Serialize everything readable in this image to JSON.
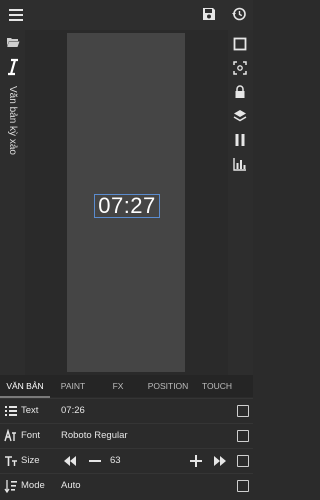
{
  "topbar": {
    "menu_icon": "menu-icon",
    "save_icon": "save-icon",
    "history_icon": "history-icon"
  },
  "left_panel": {
    "title": "Văn bản kỳ xảo"
  },
  "canvas": {
    "clock_text": "07:27"
  },
  "tabs": [
    {
      "label": "VĂN BẢN",
      "active": true
    },
    {
      "label": "PAINT",
      "active": false
    },
    {
      "label": "FX",
      "active": false
    },
    {
      "label": "POSITION",
      "active": false
    },
    {
      "label": "TOUCH",
      "active": false
    }
  ],
  "properties": {
    "text": {
      "label": "Text",
      "value": "07:26"
    },
    "font": {
      "label": "Font",
      "value": "Roboto Regular"
    },
    "size": {
      "label": "Size",
      "value": "63"
    },
    "mode": {
      "label": "Mode",
      "value": "Auto"
    }
  },
  "colors": {
    "accent": "#5b8ccf",
    "background": "#2b2b2b",
    "stage": "#454545"
  }
}
